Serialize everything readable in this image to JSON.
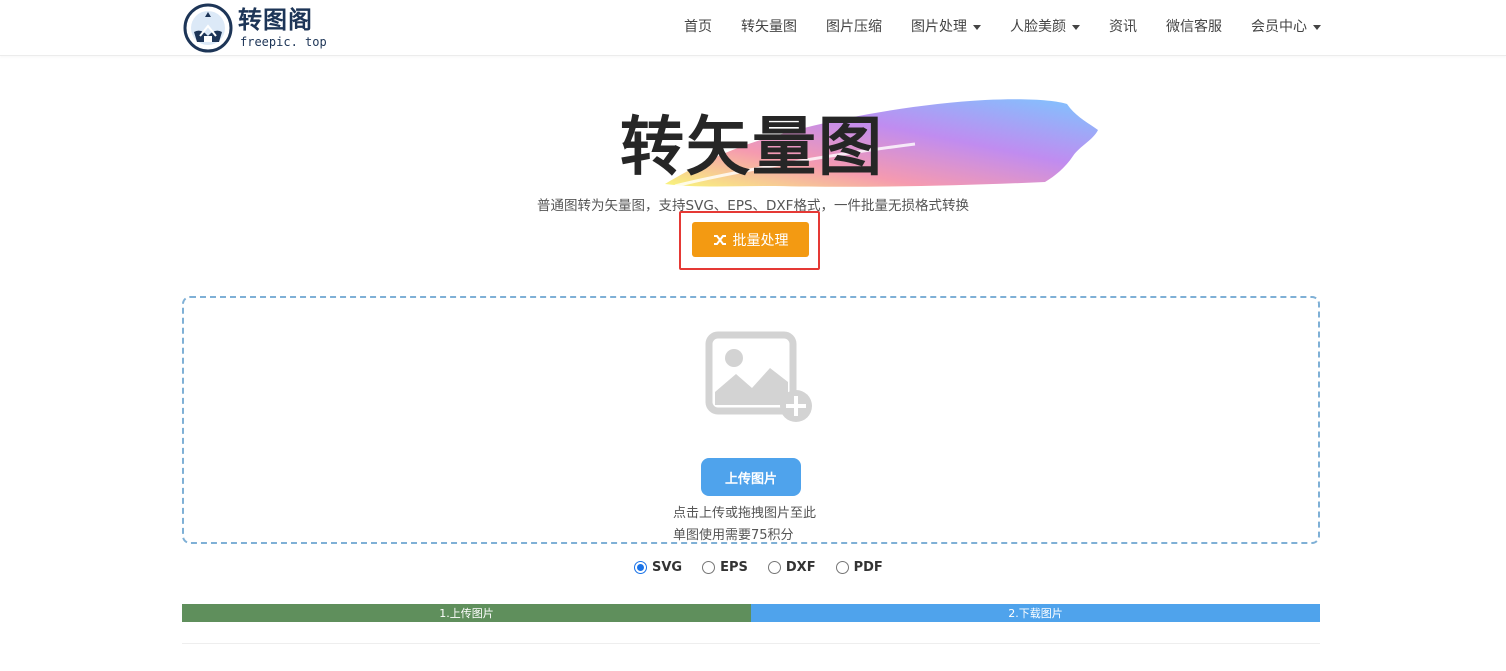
{
  "header": {
    "logo_title": "转图阁",
    "logo_sub": "freepic. top",
    "nav": [
      {
        "label": "首页",
        "dropdown": false
      },
      {
        "label": "转矢量图",
        "dropdown": false
      },
      {
        "label": "图片压缩",
        "dropdown": false
      },
      {
        "label": "图片处理",
        "dropdown": true
      },
      {
        "label": "人脸美颜",
        "dropdown": true
      },
      {
        "label": "资讯",
        "dropdown": false
      },
      {
        "label": "微信客服",
        "dropdown": false
      },
      {
        "label": "会员中心",
        "dropdown": true
      }
    ]
  },
  "hero": {
    "title": "转矢量图",
    "subtitle": "普通图转为矢量图，支持SVG、EPS、DXF格式，一件批量无损格式转换",
    "batch_label": "批量处理",
    "batch_icon": "shuffle-icon"
  },
  "upload": {
    "icon": "image-add-icon",
    "button_label": "上传图片",
    "hint": "点击上传或拖拽图片至此",
    "cost": "单图使用需要75积分"
  },
  "formats": {
    "options": [
      "SVG",
      "EPS",
      "DXF",
      "PDF"
    ],
    "selected": "SVG"
  },
  "steps": {
    "step1": "1.上传图片",
    "step2": "2.下载图片"
  },
  "colors": {
    "brand": "#1d3557",
    "batch_button": "#f39a12",
    "upload_button": "#4fa3ec",
    "step_done": "#5f8f5c",
    "step_next": "#4fa3ec",
    "highlight": "#e53935"
  }
}
